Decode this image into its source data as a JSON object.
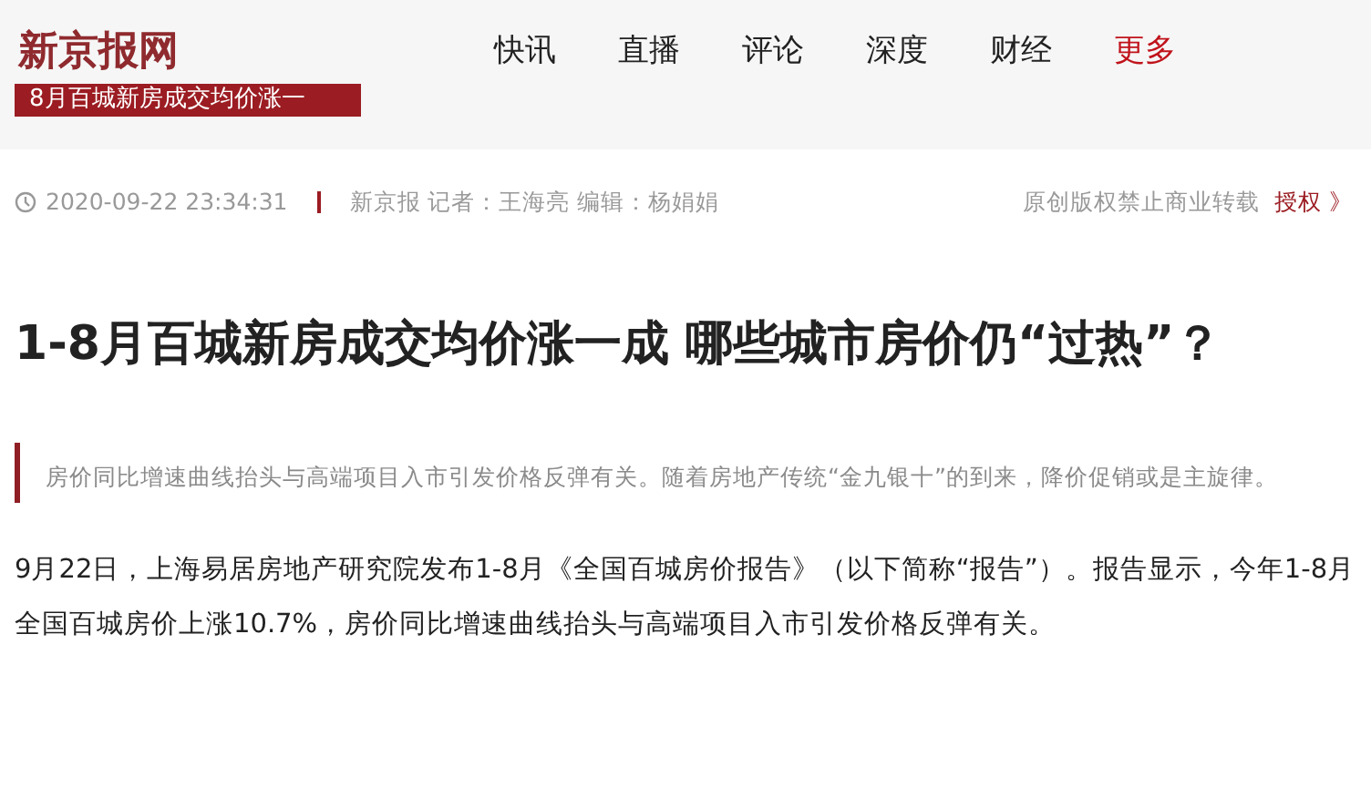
{
  "header": {
    "logo": "新京报网",
    "banner": "8月百城新房成交均价涨一",
    "nav": [
      {
        "label": "快讯",
        "highlighted": false
      },
      {
        "label": "直播",
        "highlighted": false
      },
      {
        "label": "评论",
        "highlighted": false
      },
      {
        "label": "深度",
        "highlighted": false
      },
      {
        "label": "财经",
        "highlighted": false
      },
      {
        "label": "更多",
        "highlighted": true
      }
    ]
  },
  "meta": {
    "time": "2020-09-22 23:34:31",
    "source": "新京报 记者：王海亮 编辑：杨娟娟",
    "copyright": "原创版权禁止商业转载",
    "license_link": "授权 》"
  },
  "article": {
    "title": "1-8月百城新房成交均价涨一成 哪些城市房价仍“过热”？",
    "summary": "房价同比增速曲线抬头与高端项目入市引发价格反弹有关。随着房地产传统“金九银十”的到来，降价促销或是主旋律。",
    "paragraph": "9月22日，上海易居房地产研究院发布1-8月《全国百城房价报告》（以下简称“报告”）。报告显示，今年1-8月全国百城房价上涨10.7%，房价同比增速曲线抬头与高端项目入市引发价格反弹有关。"
  }
}
